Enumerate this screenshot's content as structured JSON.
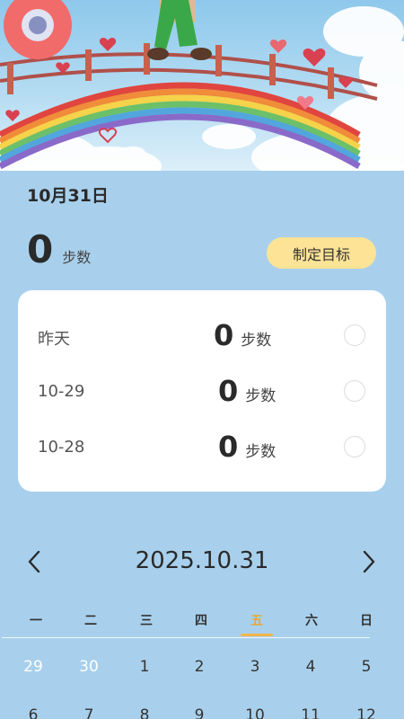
{
  "header": {
    "date": "10月31日",
    "today_steps": "0",
    "steps_unit": "步数",
    "goal_button": "制定目标"
  },
  "history": [
    {
      "label": "昨天",
      "steps": "0",
      "unit": "步数"
    },
    {
      "label": "10-29",
      "steps": "0",
      "unit": "步数"
    },
    {
      "label": "10-28",
      "steps": "0",
      "unit": "步数"
    }
  ],
  "calendar": {
    "title": "2025.10.31",
    "weekdays": [
      "一",
      "二",
      "三",
      "四",
      "五",
      "六",
      "日"
    ],
    "selected_weekday_index": 4,
    "week1": [
      "29",
      "30",
      "1",
      "2",
      "3",
      "4",
      "5"
    ],
    "week2": [
      "6",
      "7",
      "8",
      "9",
      "10",
      "11",
      "12"
    ]
  },
  "colors": {
    "background": "#a8d0ec",
    "goal_button": "#fde396",
    "accent": "#f2b64a"
  },
  "icons": {
    "prev": "chevron-left-icon",
    "next": "chevron-right-icon"
  }
}
